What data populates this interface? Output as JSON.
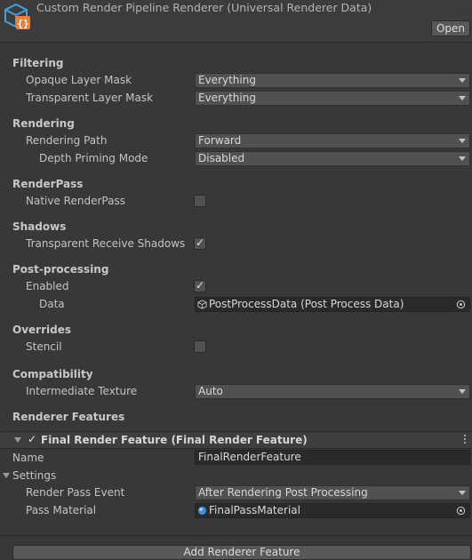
{
  "header": {
    "title": "Custom Render Pipeline Renderer (Universal Renderer Data)",
    "open_label": "Open",
    "icon": "script-asset-icon"
  },
  "filtering": {
    "title": "Filtering",
    "opaque_label": "Opaque Layer Mask",
    "opaque_value": "Everything",
    "transparent_label": "Transparent Layer Mask",
    "transparent_value": "Everything"
  },
  "rendering": {
    "title": "Rendering",
    "path_label": "Rendering Path",
    "path_value": "Forward",
    "depth_label": "Depth Priming Mode",
    "depth_value": "Disabled"
  },
  "renderpass": {
    "title": "RenderPass",
    "native_label": "Native RenderPass",
    "native_checked": false
  },
  "shadows": {
    "title": "Shadows",
    "receive_label": "Transparent Receive Shadows",
    "receive_checked": true
  },
  "postprocessing": {
    "title": "Post-processing",
    "enabled_label": "Enabled",
    "enabled_checked": true,
    "data_label": "Data",
    "data_value": "PostProcessData (Post Process Data)"
  },
  "overrides": {
    "title": "Overrides",
    "stencil_label": "Stencil",
    "stencil_checked": false
  },
  "compatibility": {
    "title": "Compatibility",
    "intermediate_label": "Intermediate Texture",
    "intermediate_value": "Auto"
  },
  "features": {
    "title": "Renderer Features",
    "feature_title": "Final Render Feature (Final Render Feature)",
    "feature_enabled": true,
    "name_label": "Name",
    "name_value": "FinalRenderFeature",
    "settings_label": "Settings",
    "event_label": "Render Pass Event",
    "event_value": "After Rendering Post Processing",
    "material_label": "Pass Material",
    "material_value": "FinalPassMaterial",
    "add_label": "Add Renderer Feature"
  },
  "colors": {
    "background": "#383838",
    "field": "#515151",
    "object_field": "#2a2a2a",
    "asset_icon_blue": "#4a9fd8",
    "asset_icon_orange": "#e8813a"
  }
}
